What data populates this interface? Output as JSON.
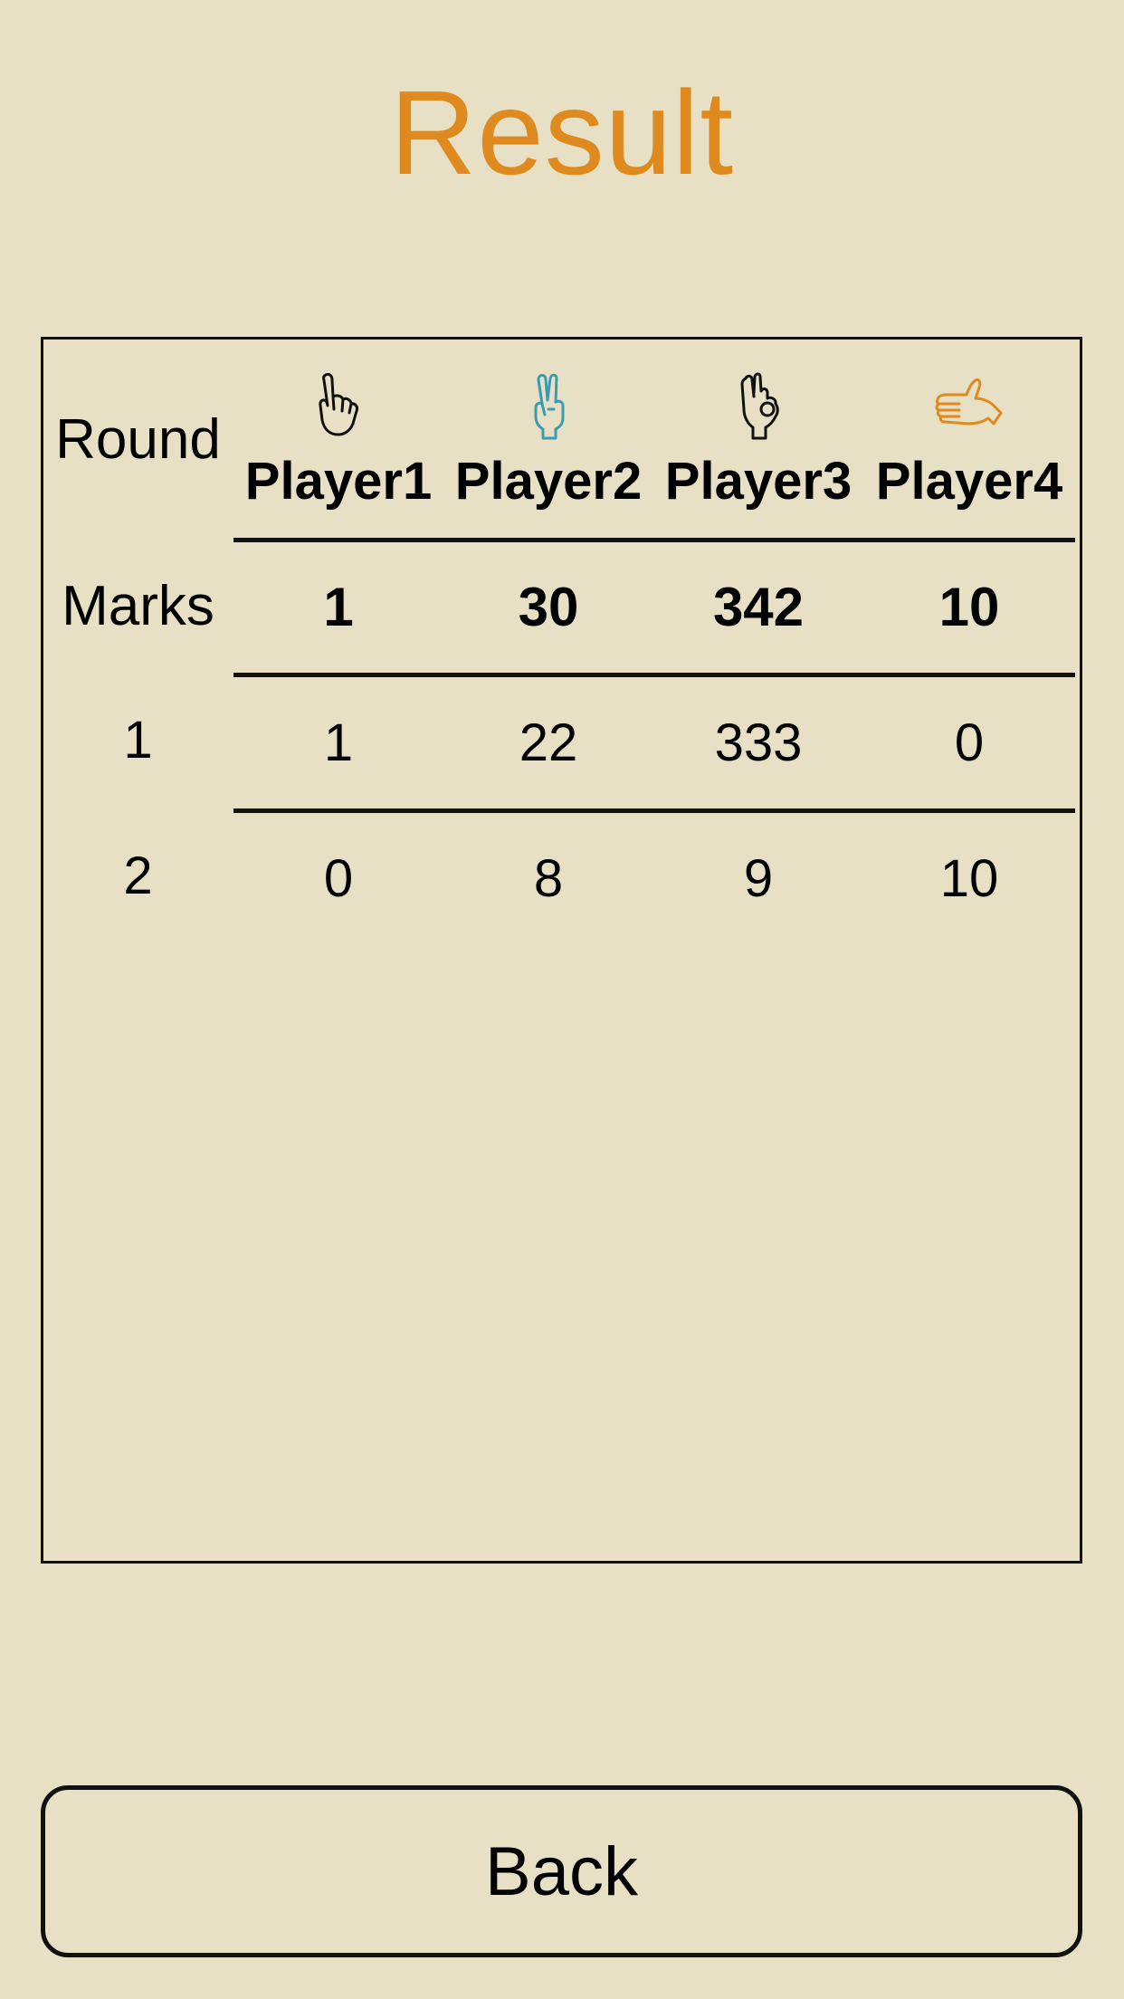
{
  "title": "Result",
  "table": {
    "round_label": "Round",
    "marks_label": "Marks",
    "players": [
      {
        "name": "Player1",
        "icon": "pointing-up-hand-icon",
        "color": "#111111"
      },
      {
        "name": "Player2",
        "icon": "victory-hand-icon",
        "color": "#3b9bb0"
      },
      {
        "name": "Player3",
        "icon": "ok-hand-icon",
        "color": "#111111"
      },
      {
        "name": "Player4",
        "icon": "open-palm-hand-icon",
        "color": "#df8a1e"
      }
    ],
    "marks": [
      "1",
      "30",
      "342",
      "10"
    ],
    "rounds": [
      {
        "round": "1",
        "values": [
          "1",
          "22",
          "333",
          "0"
        ]
      },
      {
        "round": "2",
        "values": [
          "0",
          "8",
          "9",
          "10"
        ]
      }
    ]
  },
  "back_button": "Back",
  "colors": {
    "background": "#e8e0c5",
    "accent": "#df8a1e"
  }
}
